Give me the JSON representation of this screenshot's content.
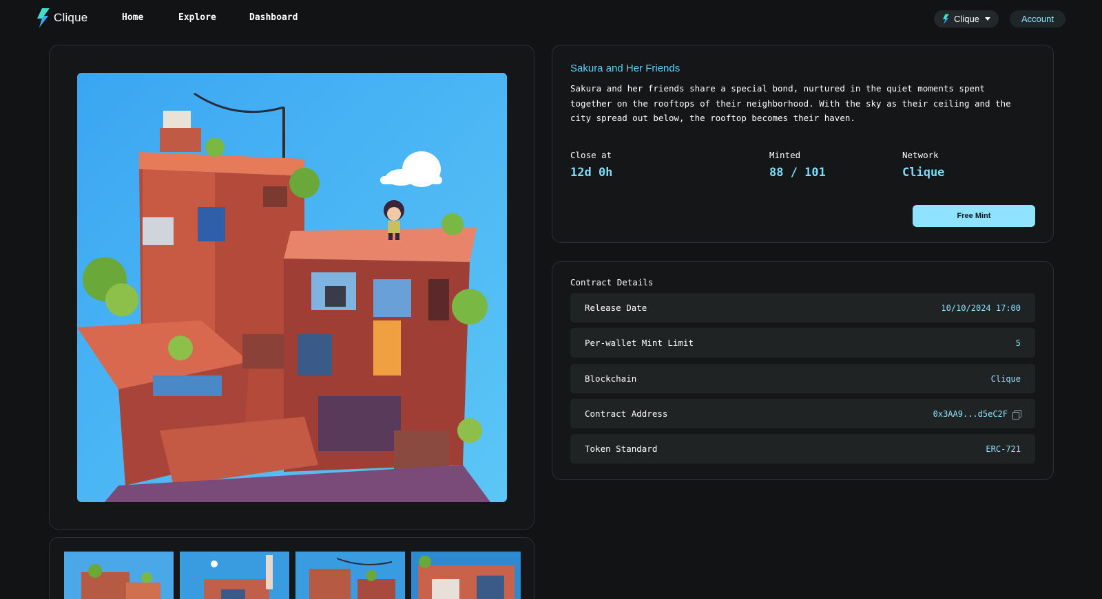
{
  "brand": {
    "name": "Clique"
  },
  "nav": {
    "links": [
      "Home",
      "Explore",
      "Dashboard"
    ],
    "network_label": "Clique",
    "account_label": "Account"
  },
  "colors": {
    "background": "#121314",
    "accent": "#5ed1ff",
    "button": "#8fe3ff"
  },
  "collection": {
    "title": "Sakura and Her Friends",
    "description": "Sakura and her friends share a special bond, nurtured in the quiet moments spent together on the rooftops of their neighborhood. With the sky as their ceiling and the city spread out below, the rooftop becomes their haven.",
    "stats": [
      {
        "label": "Close at",
        "value": "12d 0h"
      },
      {
        "label": "Minted",
        "value": "88 / 101"
      },
      {
        "label": "Network",
        "value": "Clique"
      }
    ],
    "mint_button": "Free Mint"
  },
  "contract": {
    "title": "Contract Details",
    "rows": [
      {
        "label": "Release Date",
        "value": "10/10/2024 17:00"
      },
      {
        "label": "Per-wallet Mint Limit",
        "value": "5"
      },
      {
        "label": "Blockchain",
        "value": "Clique"
      },
      {
        "label": "Contract Address",
        "value": "0x3AA9...d5eC2F"
      },
      {
        "label": "Token Standard",
        "value": "ERC-721"
      }
    ]
  },
  "icons": [
    "lightning-logo-icon",
    "lightning-icon",
    "chevron-down-icon",
    "copy-icon"
  ]
}
